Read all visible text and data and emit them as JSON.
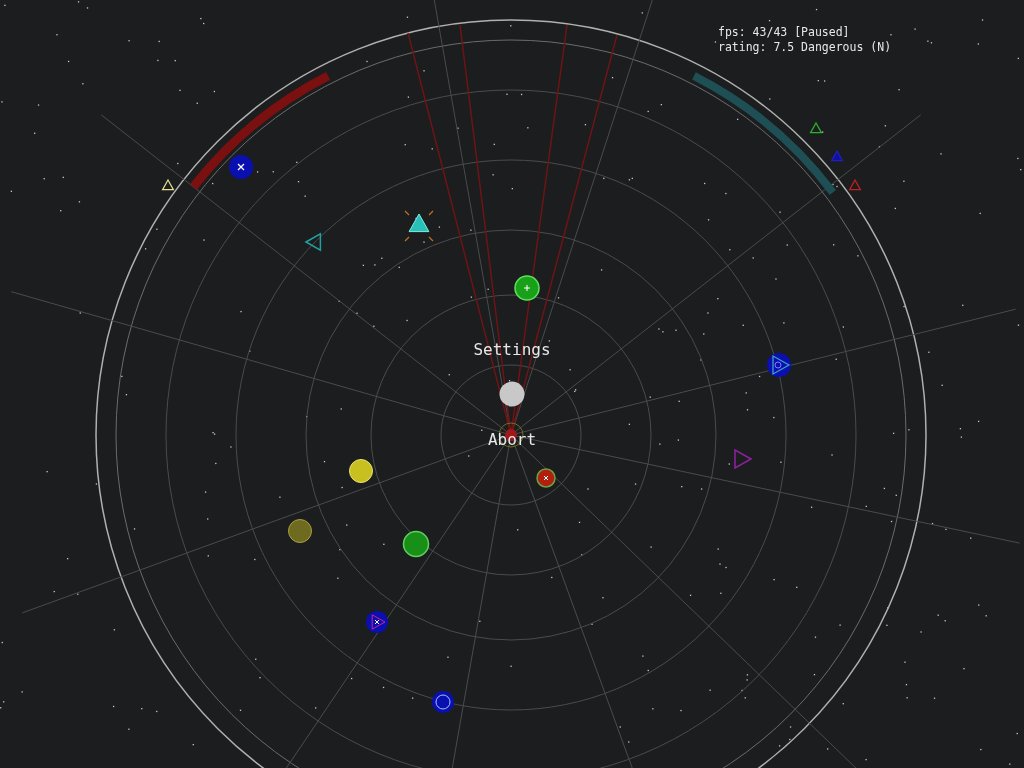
{
  "hud": {
    "fps": "fps: 43/43 [Paused]",
    "rating": "rating: 7.5 Dangerous (N)"
  },
  "menu": [
    {
      "label": "Settings"
    },
    {
      "label": "Abort"
    }
  ]
}
